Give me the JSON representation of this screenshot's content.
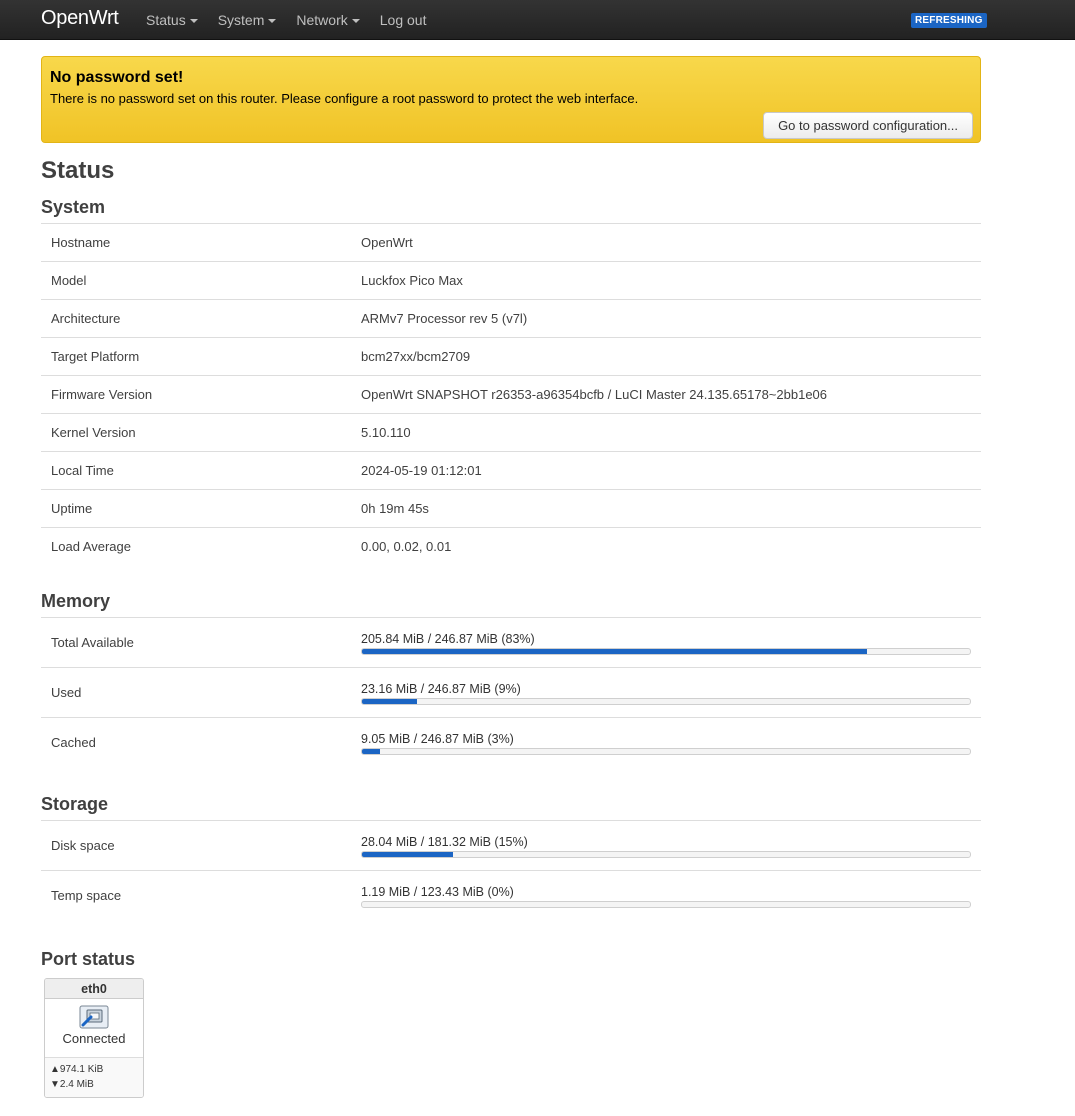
{
  "header": {
    "brand": "OpenWrt",
    "menu": [
      {
        "label": "Status",
        "dropdown": true
      },
      {
        "label": "System",
        "dropdown": true
      },
      {
        "label": "Network",
        "dropdown": true
      },
      {
        "label": "Log out",
        "dropdown": false
      }
    ],
    "indicator": "REFRESHING",
    "indicator_color": "#1b65c4"
  },
  "alert": {
    "title": "No password set!",
    "message": "There is no password set on this router. Please configure a root password to protect the web interface.",
    "button": "Go to password configuration...",
    "color": "#f0c326"
  },
  "page": {
    "title": "Status"
  },
  "system": {
    "heading": "System",
    "rows": [
      {
        "label": "Hostname",
        "value": "OpenWrt"
      },
      {
        "label": "Model",
        "value": "Luckfox Pico Max"
      },
      {
        "label": "Architecture",
        "value": "ARMv7 Processor rev 5 (v7l)"
      },
      {
        "label": "Target Platform",
        "value": "bcm27xx/bcm2709"
      },
      {
        "label": "Firmware Version",
        "value": "OpenWrt SNAPSHOT r26353-a96354bcfb / LuCI Master 24.135.65178~2bb1e06"
      },
      {
        "label": "Kernel Version",
        "value": "5.10.110"
      },
      {
        "label": "Local Time",
        "value": "2024-05-19 01:12:01"
      },
      {
        "label": "Uptime",
        "value": "0h 19m 45s"
      },
      {
        "label": "Load Average",
        "value": "0.00, 0.02, 0.01"
      }
    ]
  },
  "memory": {
    "heading": "Memory",
    "rows": [
      {
        "label": "Total Available",
        "text": "205.84 MiB / 246.87 MiB (83%)",
        "percent": 83
      },
      {
        "label": "Used",
        "text": "23.16 MiB / 246.87 MiB (9%)",
        "percent": 9
      },
      {
        "label": "Cached",
        "text": "9.05 MiB / 246.87 MiB (3%)",
        "percent": 3
      }
    ]
  },
  "storage": {
    "heading": "Storage",
    "rows": [
      {
        "label": "Disk space",
        "text": "28.04 MiB / 181.32 MiB (15%)",
        "percent": 15
      },
      {
        "label": "Temp space",
        "text": "1.19 MiB / 123.43 MiB (0%)",
        "percent": 0
      }
    ]
  },
  "ports": {
    "heading": "Port status",
    "items": [
      {
        "name": "eth0",
        "state": "Connected",
        "icon": "ethernet-port-icon",
        "tx": "▲974.1 KiB",
        "rx": "▼2.4 MiB"
      }
    ]
  },
  "colors": {
    "bar_fill": "#1b65c4",
    "navbar": "#222222"
  }
}
